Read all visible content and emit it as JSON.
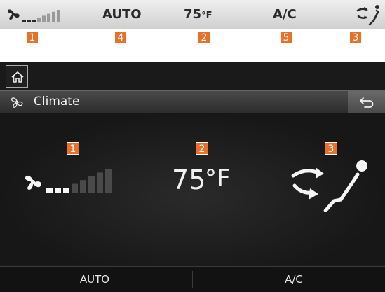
{
  "legend": {
    "auto": "AUTO",
    "temperature": "75",
    "temp_unit": "°F",
    "ac": "A/C",
    "callouts": [
      "1",
      "4",
      "2",
      "5",
      "3"
    ]
  },
  "screen": {
    "title": "Climate",
    "callouts": [
      "1",
      "2",
      "3"
    ],
    "temperature": "75",
    "temp_unit": "°F",
    "fan_level": 0.375,
    "bottom_buttons": [
      "AUTO",
      "A/C"
    ]
  },
  "icons": {
    "home": "home-icon",
    "fan": "fan-icon",
    "back": "back-arrow-icon",
    "airflow": "airflow-mode-icon"
  },
  "colors": {
    "callout": "#e8712a",
    "screen_bg": "#1a1a1a",
    "text": "#f0f0f0"
  }
}
